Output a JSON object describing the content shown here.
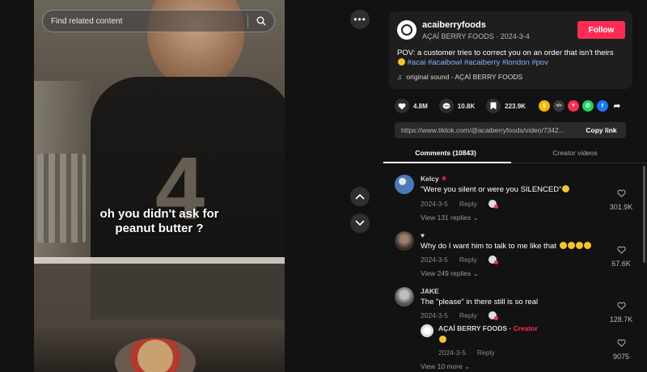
{
  "search": {
    "placeholder": "Find related content"
  },
  "video": {
    "caption_line1": "oh you didn't ask for",
    "caption_line2": "peanut butter ?",
    "shirt_number": "4"
  },
  "post": {
    "username": "acaiberryfoods",
    "nickname": "AÇAÍ BERRY FOODS",
    "date": "2024-3-4",
    "follow_label": "Follow",
    "description": "POV: a customer tries to correct you on an order that isn't theirs",
    "hashtags": [
      "#acai",
      "#acaibowl",
      "#acaiberry",
      "#london",
      "#pov"
    ],
    "sound": "original sound - AÇAÍ BERRY FOODS"
  },
  "stats": {
    "likes": "4.8M",
    "comments": "10.8K",
    "saves": "223.9K"
  },
  "share_icons": [
    {
      "name": "coin-icon",
      "color": "#f5b800",
      "glyph": "$"
    },
    {
      "name": "embed-icon",
      "color": "#3a3a3a",
      "glyph": "</>"
    },
    {
      "name": "send-icon",
      "color": "#fe2c55",
      "glyph": "▼"
    },
    {
      "name": "whatsapp-icon",
      "color": "#25d366",
      "glyph": "✆"
    },
    {
      "name": "facebook-icon",
      "color": "#1877f2",
      "glyph": "f"
    },
    {
      "name": "share-arrow-icon",
      "color": "transparent",
      "glyph": "➦"
    }
  ],
  "link": {
    "url": "https://www.tiktok.com/@acaiberryfoods/video/7342...",
    "copy_label": "Copy link"
  },
  "tabs": {
    "comments": "Comments (10843)",
    "creator": "Creator videos"
  },
  "comments": [
    {
      "author": "Kelcy",
      "text": "\"Were you silent or were you SILENCED\"",
      "date": "2024-3-5",
      "reply": "Reply",
      "likes": "301.9K",
      "views": "View 131 replies",
      "avatar_color": "#4a7ab8"
    },
    {
      "author": "♥",
      "text": "Why do I want him to talk to me like that",
      "date": "2024-3-5",
      "reply": "Reply",
      "likes": "67.6K",
      "views": "View 249 replies",
      "avatar_color": "#6a5a50"
    },
    {
      "author": "JAKE",
      "text": "The \"please\" in there still is so real",
      "date": "2024-3-5",
      "reply": "Reply",
      "likes": "128.7K",
      "views": "",
      "avatar_color": "#7a7a7a"
    }
  ],
  "creator_reply": {
    "author": "AÇAÍ BERRY FOODS",
    "badge": "Creator",
    "date": "2024-3-5",
    "reply": "Reply",
    "likes": "9075",
    "views": "View 10 more"
  }
}
